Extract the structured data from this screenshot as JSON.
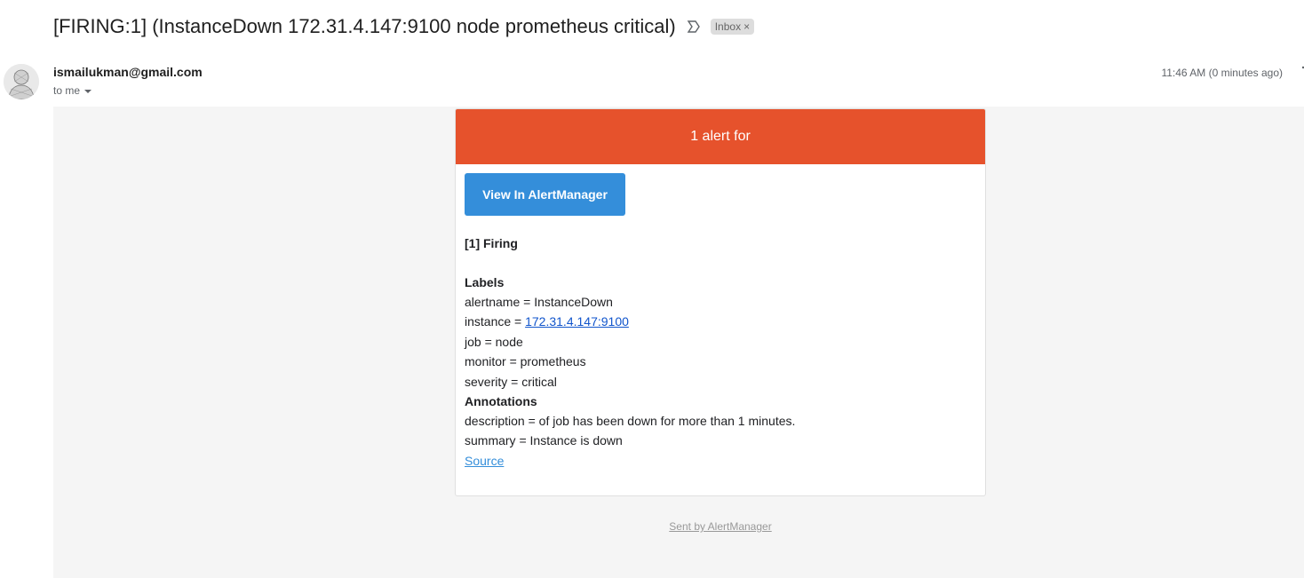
{
  "email": {
    "subject": "[FIRING:1] (InstanceDown 172.31.4.147:9100 node prometheus critical)",
    "label_chip": "Inbox",
    "label_chip_close": "×",
    "sender": "ismailukman@gmail.com",
    "recipient": "to me",
    "timestamp": "11:46 AM (0 minutes ago)"
  },
  "alert": {
    "header": "1 alert for",
    "button_label": "View In AlertManager",
    "firing_title": "[1] Firing",
    "labels_title": "Labels",
    "labels": {
      "alertname": "alertname = InstanceDown",
      "instance_prefix": "instance = ",
      "instance_value": "172.31.4.147:9100",
      "job": "job = node",
      "monitor": "monitor = prometheus",
      "severity": "severity = critical"
    },
    "annotations_title": "Annotations",
    "annotations": {
      "description": "description = of job has been down for more than 1 minutes.",
      "summary": "summary = Instance is down"
    },
    "source_link": "Source",
    "footer": "Sent by AlertManager"
  },
  "colors": {
    "header_bg": "#e6522c",
    "button_bg": "#348eda",
    "body_bg": "#f5f5f5"
  }
}
